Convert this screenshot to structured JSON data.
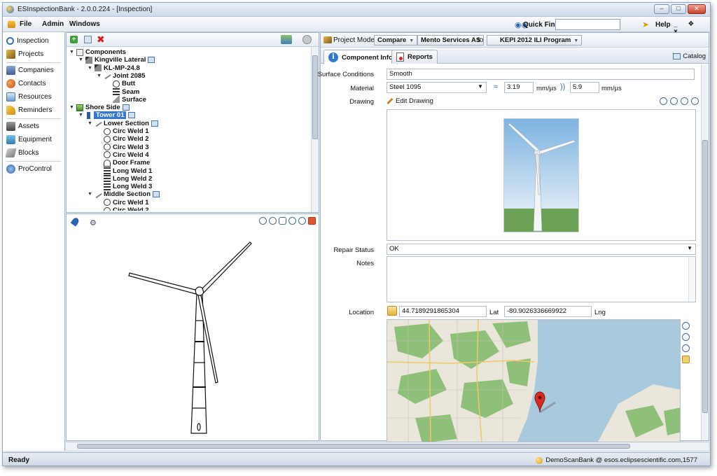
{
  "window": {
    "title": "ESInspectionBank - 2.0.0.224 - [Inspection]"
  },
  "menu": {
    "items": [
      "File",
      "Admin",
      "Windows"
    ],
    "quick_find_label": "Quick Find",
    "quick_find_value": "",
    "help_label": "Help",
    "mdi_controls": "_ ❖ ×"
  },
  "nav": {
    "items": [
      {
        "label": "Inspection",
        "icon": "magnifier-icon",
        "color": "#3a6fb8"
      },
      {
        "label": "Projects",
        "icon": "projects-icon",
        "color": "#b9852a"
      },
      {
        "label": "Companies",
        "icon": "companies-icon",
        "color": "#4c6fa0"
      },
      {
        "label": "Contacts",
        "icon": "contacts-icon",
        "color": "#d06a2a"
      },
      {
        "label": "Resources",
        "icon": "resources-icon",
        "color": "#6b9bd2"
      },
      {
        "label": "Reminders",
        "icon": "reminders-icon",
        "color": "#e0a418"
      },
      {
        "label": "Assets",
        "icon": "assets-icon",
        "color": "#555555"
      },
      {
        "label": "Equipment",
        "icon": "equipment-icon",
        "color": "#3b8bbf"
      },
      {
        "label": "Blocks",
        "icon": "blocks-icon",
        "color": "#8e8e8e"
      },
      {
        "label": "ProControl",
        "icon": "procontrol-icon",
        "color": "#3a6fb8"
      }
    ]
  },
  "tree": {
    "nodes": [
      {
        "label": "Components",
        "level": 0,
        "icon": "comp",
        "toggle": "▼"
      },
      {
        "label": "Kingville Lateral",
        "level": 1,
        "icon": "pipe",
        "toggle": "▼",
        "badge": true
      },
      {
        "label": "KL-MP-24.8",
        "level": 2,
        "icon": "pipe",
        "toggle": "▼"
      },
      {
        "label": "Joint 2085",
        "level": 3,
        "icon": "joint",
        "toggle": "▼"
      },
      {
        "label": "Butt",
        "level": 4,
        "icon": "weld"
      },
      {
        "label": "Seam",
        "level": 4,
        "icon": "seam"
      },
      {
        "label": "Surface",
        "level": 4,
        "icon": "surface"
      },
      {
        "label": "Shore Side",
        "level": 0,
        "icon": "site",
        "toggle": "▼",
        "badge": true
      },
      {
        "label": "Tower 01",
        "level": 1,
        "icon": "tower",
        "toggle": "▼",
        "badge": true,
        "selected": true
      },
      {
        "label": "Lower Section",
        "level": 2,
        "icon": "joint",
        "toggle": "▼",
        "badge": true
      },
      {
        "label": "Circ Weld 1",
        "level": 3,
        "icon": "weld"
      },
      {
        "label": "Circ Weld 2",
        "level": 3,
        "icon": "weld"
      },
      {
        "label": "Circ Weld 3",
        "level": 3,
        "icon": "weld"
      },
      {
        "label": "Circ Weld 4",
        "level": 3,
        "icon": "weld"
      },
      {
        "label": "Door Frame",
        "level": 3,
        "icon": "door"
      },
      {
        "label": "Long Weld 1",
        "level": 3,
        "icon": "seam"
      },
      {
        "label": "Long Weld 2",
        "level": 3,
        "icon": "seam"
      },
      {
        "label": "Long Weld 3",
        "level": 3,
        "icon": "seam"
      },
      {
        "label": "Middle Section",
        "level": 2,
        "icon": "joint",
        "toggle": "▼",
        "badge": true
      },
      {
        "label": "Circ Weld 1",
        "level": 3,
        "icon": "weld"
      },
      {
        "label": "Circ Weld 2",
        "level": 3,
        "icon": "weld"
      }
    ]
  },
  "project_bar": {
    "label": "Project Mode:",
    "mode": "Compare",
    "company": "Mento Services AS",
    "to_label": "to",
    "program": "KEPI 2012 ILI Program"
  },
  "tabs": {
    "component_info": "Component Info",
    "reports": "Reports",
    "catalog": "Catalog"
  },
  "form": {
    "surface_conditions_label": "Surface Conditions",
    "surface_conditions_value": "Smooth",
    "material_label": "Material",
    "material_value": "Steel 1095",
    "velocity1_value": "3.19",
    "velocity1_unit": "mm/µs",
    "velocity2_value": "5.9",
    "velocity2_unit": "mm/µs",
    "drawing_label": "Drawing",
    "edit_drawing_label": "Edit Drawing",
    "repair_status_label": "Repair Status",
    "repair_status_value": "OK",
    "notes_label": "Notes",
    "notes_value": "",
    "location_label": "Location",
    "lat_value": "44.7189291865304",
    "lat_label": "Lat",
    "lng_value": "-80.9026336669922",
    "lng_label": "Lng"
  },
  "status": {
    "left": "Ready",
    "right": "DemoScanBank @ esos.eclipsescientific.com,1577"
  },
  "colors": {
    "selection": "#3477d8",
    "map_water": "#a9c9dc",
    "map_land": "#eae6dc",
    "map_forest": "#8fc07a",
    "pin": "#d82a20"
  }
}
